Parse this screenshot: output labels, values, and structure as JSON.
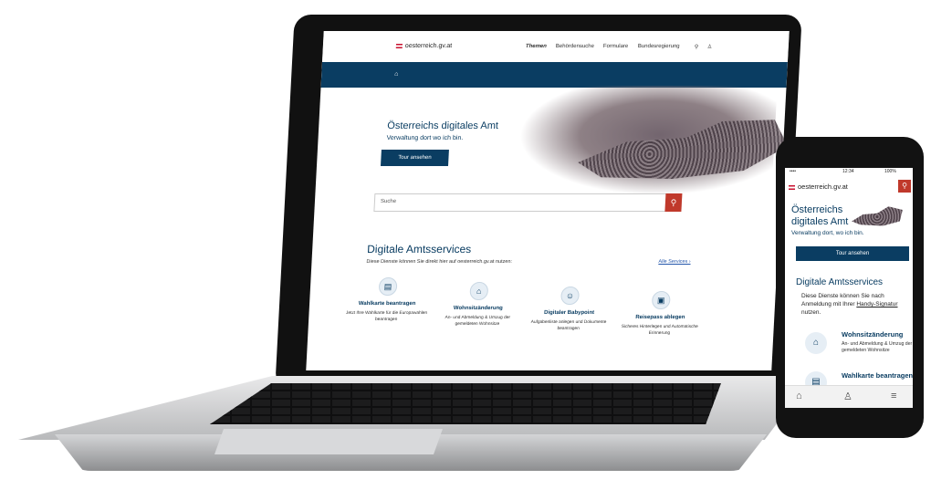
{
  "laptop": {
    "header": {
      "logo": "oesterreich.gv.at",
      "nav": [
        "Themen",
        "Behördensuche",
        "Formulare",
        "Bundesregierung"
      ],
      "active_nav": "Themen"
    },
    "hero": {
      "title": "Österreichs digitales Amt",
      "subtitle": "Verwaltung dort wo ich bin.",
      "button": "Tour ansehen",
      "search_placeholder": "Suche"
    },
    "services_section": {
      "title": "Digitale Amtsservices",
      "subtitle": "Diese Dienste können Sie direkt hier auf oesterreich.gv.at nutzen:",
      "all_link": "Alle Services ›",
      "items": [
        {
          "title": "Wahlkarte beantragen",
          "desc": "Jetzt Ihre Wahlkarte für die Europawahlen beantragen",
          "icon": "ballot-icon"
        },
        {
          "title": "Wohnsitzänderung",
          "desc": "An- und Abmeldung & Umzug der gemeldeten Wohnsitze",
          "icon": "house-icon"
        },
        {
          "title": "Digitaler Babypoint",
          "desc": "Aufgabenliste anlegen und Dokumente beantragen",
          "icon": "baby-icon"
        },
        {
          "title": "Reisepass ablegen",
          "desc": "Sicheres Hinterlegen und Automatische Erinnerung",
          "icon": "passport-icon"
        }
      ]
    }
  },
  "phone": {
    "status": {
      "carrier": "•••• ",
      "time": "12:34",
      "battery": "100%"
    },
    "logo": "oesterreich.gv.at",
    "hero": {
      "title": "Österreichs digitales Amt",
      "subtitle": "Verwaltung dort, wo ich bin.",
      "button": "Tour ansehen"
    },
    "section_title": "Digitale Amtsservices",
    "section_desc_prefix": "Diese Dienste können Sie nach Anmeldung mit Ihrer ",
    "section_desc_link": "Handy-Signatur",
    "section_desc_suffix": " nutzen.",
    "cards": [
      {
        "title": "Wohnsitzänderung",
        "desc": "An- und Abmeldung & Umzug der gemeldeten Wohnsitze"
      },
      {
        "title": "Wahlkarte beantragen",
        "desc": ""
      }
    ]
  },
  "colors": {
    "primary": "#0a3d62",
    "accent": "#c0392b"
  }
}
